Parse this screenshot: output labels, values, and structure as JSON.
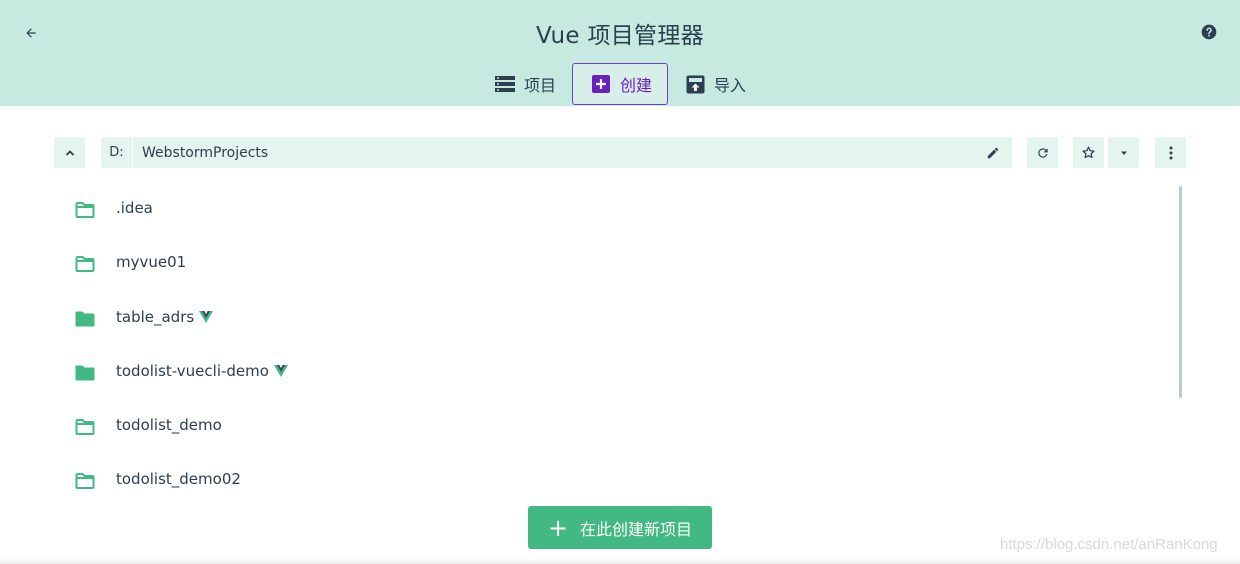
{
  "header": {
    "title": "Vue 项目管理器",
    "back_icon": "arrow-left-icon",
    "help_icon": "help-circle-icon",
    "background": "#c6eadf"
  },
  "tabs": [
    {
      "label": "项目",
      "icon": "list-icon",
      "active": false
    },
    {
      "label": "创建",
      "icon": "add-box-icon",
      "active": true
    },
    {
      "label": "导入",
      "icon": "unarchive-icon",
      "active": false
    }
  ],
  "toolbar": {
    "drive": "D:",
    "path_segment": "WebstormProjects",
    "icons": [
      "chevron-up-icon",
      "pencil-icon",
      "refresh-icon",
      "star-outline-icon",
      "caret-down-icon",
      "more-vertical-icon"
    ]
  },
  "folders": [
    {
      "name": ".idea",
      "filled": false,
      "vue": false
    },
    {
      "name": "myvue01",
      "filled": false,
      "vue": false
    },
    {
      "name": "table_adrs",
      "filled": true,
      "vue": true
    },
    {
      "name": "todolist-vuecli-demo",
      "filled": true,
      "vue": true
    },
    {
      "name": "todolist_demo",
      "filled": false,
      "vue": false
    },
    {
      "name": "todolist_demo02",
      "filled": false,
      "vue": false
    }
  ],
  "create_button": {
    "label": "在此创建新项目",
    "icon": "plus-icon"
  },
  "watermark": "https://blog.csdn.net/anRanKong",
  "colors": {
    "accent": "#42b983",
    "active_tab": "#6a1fbf",
    "text": "#2c3e50"
  }
}
